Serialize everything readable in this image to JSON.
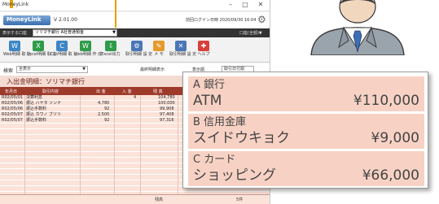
{
  "window": {
    "title": "MoneyLink",
    "controls": [
      "–",
      "□",
      "✕"
    ],
    "app_name": "MoneyLink",
    "version": "V 2.01.00",
    "timestamp": "前回ログイン日時 2020/09/30 16:04",
    "bank_label": "表示する口座",
    "selected_account": "ソリマチ銀行 A社普通預金",
    "account_dropdown": "口座(全額)▼"
  },
  "toolbar": [
    {
      "label": "Web明細\n取 込",
      "icon": "web-import-icon",
      "color": "#3d86c6"
    },
    {
      "label": "Excel明細\n取 込",
      "icon": "excel-import-icon",
      "color": "#2f9b4b"
    },
    {
      "label": "CSV明細\n取 込",
      "icon": "csv-import-icon",
      "color": "#3d86c6"
    },
    {
      "label": "Web明細\n作 成",
      "icon": "web-create-icon",
      "color": "#2f9b4b"
    },
    {
      "label": "Excel出力",
      "icon": "excel-export-icon",
      "color": "#2f9b4b"
    },
    {
      "label": "取引明細\n設 定",
      "icon": "settings-icon",
      "color": "#4a76b8"
    },
    {
      "label": "メ モ",
      "icon": "memo-icon",
      "color": "#e59a2c"
    },
    {
      "label": "取引明細\n設 定",
      "icon": "transfer-icon",
      "color": "#4a76b8"
    },
    {
      "label": "ヘルプ",
      "icon": "help-icon",
      "color": "#d8403a"
    }
  ],
  "filter": {
    "label": "検索",
    "select": "全表示",
    "checkbox_label": "最終明細表示",
    "display_label": "表示順",
    "order_select": "取引日付順"
  },
  "section_title": "入出金明細：ソリマチ銀行",
  "columns": [
    "年月日",
    "取引内容",
    "出 金",
    "入 金",
    "残 高"
  ],
  "rows": [
    {
      "date": "R02/05/01",
      "desc": "決算利息",
      "withdraw": "",
      "deposit": "4",
      "balance": "104,780"
    },
    {
      "date": "R02/05/06",
      "desc": "振込 ハヤタ ソンナ",
      "withdraw": "4,780",
      "deposit": "",
      "balance": "100,000"
    },
    {
      "date": "R02/05/06",
      "desc": "振込手数料",
      "withdraw": "92",
      "deposit": "",
      "balance": "99,908"
    },
    {
      "date": "R02/05/07",
      "desc": "振込 カワノ ブツリ",
      "withdraw": "2,500",
      "deposit": "",
      "balance": "97,408"
    },
    {
      "date": "R02/05/07",
      "desc": "振込手数料",
      "withdraw": "92",
      "deposit": "",
      "balance": "97,316"
    }
  ],
  "footer": {
    "label": "残高",
    "value": "5件"
  },
  "callout": [
    {
      "bank": "A 銀行",
      "name": "ATM",
      "amount": "¥110,000"
    },
    {
      "bank": "B 信用金庫",
      "name": "スイドウキョク",
      "amount": "¥9,000"
    },
    {
      "bank": "C カード",
      "name": "ショッピング",
      "amount": "¥66,000"
    }
  ],
  "colors": {
    "accent": "#e8a000",
    "header": "#9e3a2a",
    "card": "#f7d2c4",
    "row": "#fbe3da"
  }
}
